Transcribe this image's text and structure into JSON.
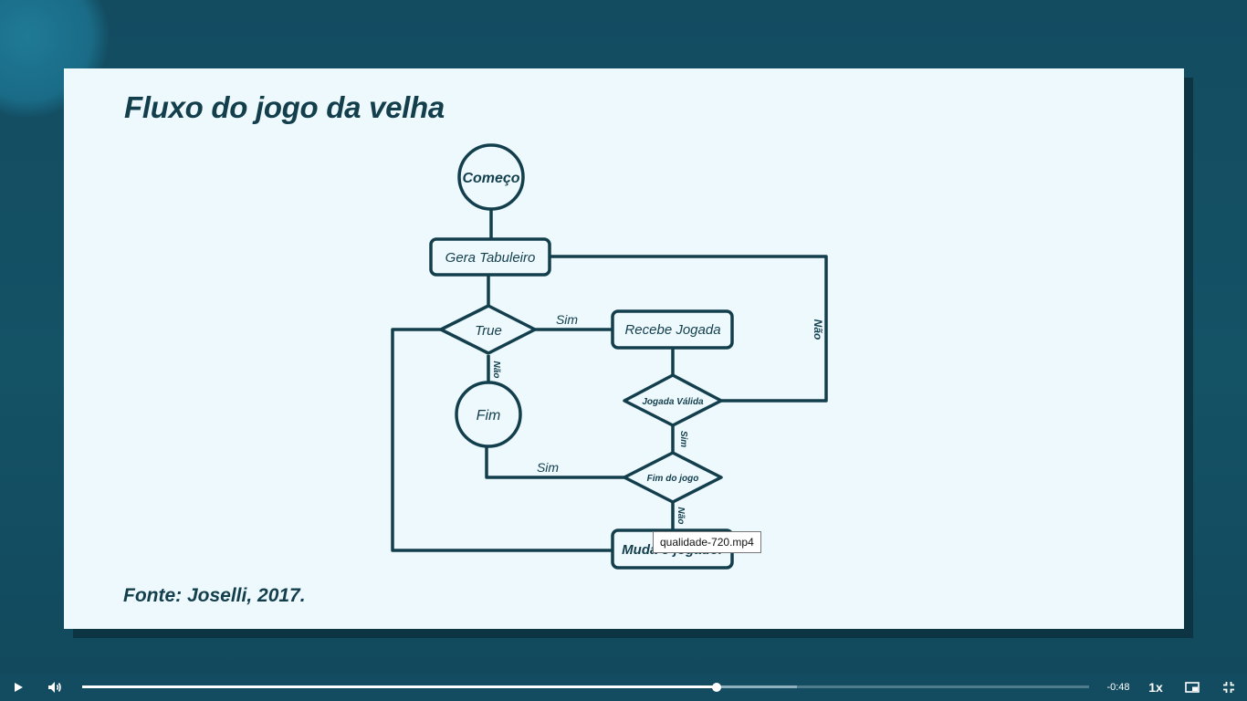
{
  "slide": {
    "title": "Fluxo do jogo da velha",
    "source": "Fonte: Joselli, 2017."
  },
  "flowchart": {
    "nodes": {
      "start": "Começo",
      "generate_board": "Gera Tabuleiro",
      "loop_true": "True",
      "receive_move": "Recebe Jogada",
      "end": "Fim",
      "valid_move": "Jogada Válida",
      "game_over": "Fim do jogo",
      "change_player": "Muda o jogador"
    },
    "edge_labels": {
      "true_to_receive": "Sim",
      "true_to_end": "Não",
      "valid_to_generate": "Não",
      "valid_to_gameover": "Sim",
      "gameover_to_end": "Sim",
      "gameover_to_change": "Não"
    }
  },
  "tooltip": {
    "text": "qualidade-720.mp4"
  },
  "player": {
    "progress_fraction": 0.63,
    "buffered_fraction": 0.71,
    "time_remaining": "-0:48",
    "speed": "1x",
    "icons": {
      "play": "play-icon",
      "volume": "volume-icon",
      "pip": "picture-in-picture-icon",
      "exit_fullscreen": "exit-fullscreen-icon"
    }
  },
  "colors": {
    "slide_bg": "#eef9fe",
    "diagram_stroke": "#133f4d",
    "stage_bg": "#134c61"
  }
}
